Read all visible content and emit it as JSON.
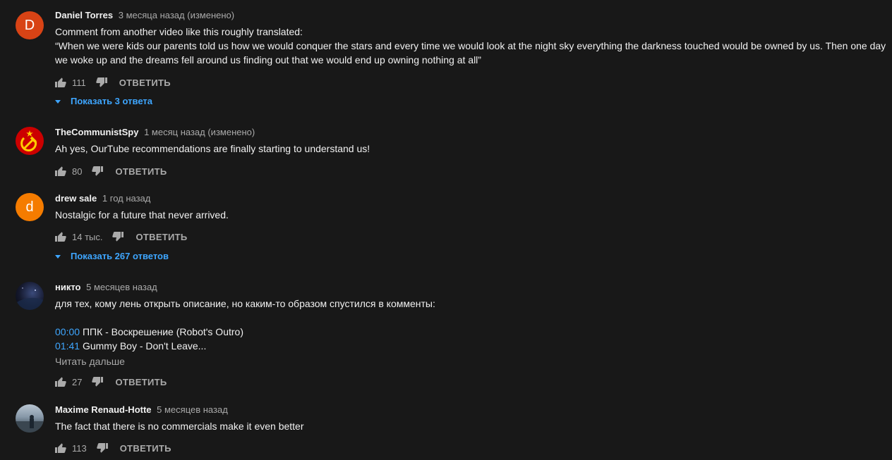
{
  "ui": {
    "reply_label": "ОТВЕТИТЬ"
  },
  "comments": [
    {
      "author": "Daniel Torres",
      "avatar_letter": "D",
      "avatar_color": "#d84315",
      "time": "3 месяца назад (изменено)",
      "lines": [
        "Comment from another video like this roughly translated:",
        "“When we were kids our parents told us how we would conquer the stars and every time we would look at the night sky everything the darkness touched would be owned by us. Then one day",
        "we woke up and the dreams fell around us finding out that we would end up owning nothing at all”"
      ],
      "likes": "111",
      "show_replies": "Показать 3 ответа"
    },
    {
      "author": "TheCommunistSpy",
      "avatar_icon": "hammer-sickle-icon",
      "avatar_color": "#cc0000",
      "time": "1 месяц назад (изменено)",
      "lines": [
        "Ah yes, OurTube recommendations are finally starting to understand us!"
      ],
      "likes": "80"
    },
    {
      "author": "drew sale",
      "avatar_letter": "d",
      "avatar_color": "#f57c00",
      "time": "1 год назад",
      "lines": [
        "Nostalgic for a future that never arrived."
      ],
      "likes": "14 тыс.",
      "show_replies": "Показать 267 ответов"
    },
    {
      "author": "никто",
      "avatar_icon": "earth-from-space-icon",
      "time": "5 месяцев назад",
      "lines": [
        "для тех, кому лень открыть описание, но каким-то образом спустился в комменты:"
      ],
      "tracks": [
        {
          "time": "00:00",
          "title": "ППК - Воскрешение (Robot's Outro)"
        },
        {
          "time": "01:41",
          "title": "Gummy Boy - Don't Leave..."
        }
      ],
      "read_more": "Читать дальше",
      "likes": "27"
    },
    {
      "author": "Maxime Renaud-Hotte",
      "avatar_icon": "photo-avatar-icon",
      "time": "5 месяцев назад",
      "lines": [
        "The fact that there is no commercials make it even better"
      ],
      "likes": "113"
    }
  ]
}
